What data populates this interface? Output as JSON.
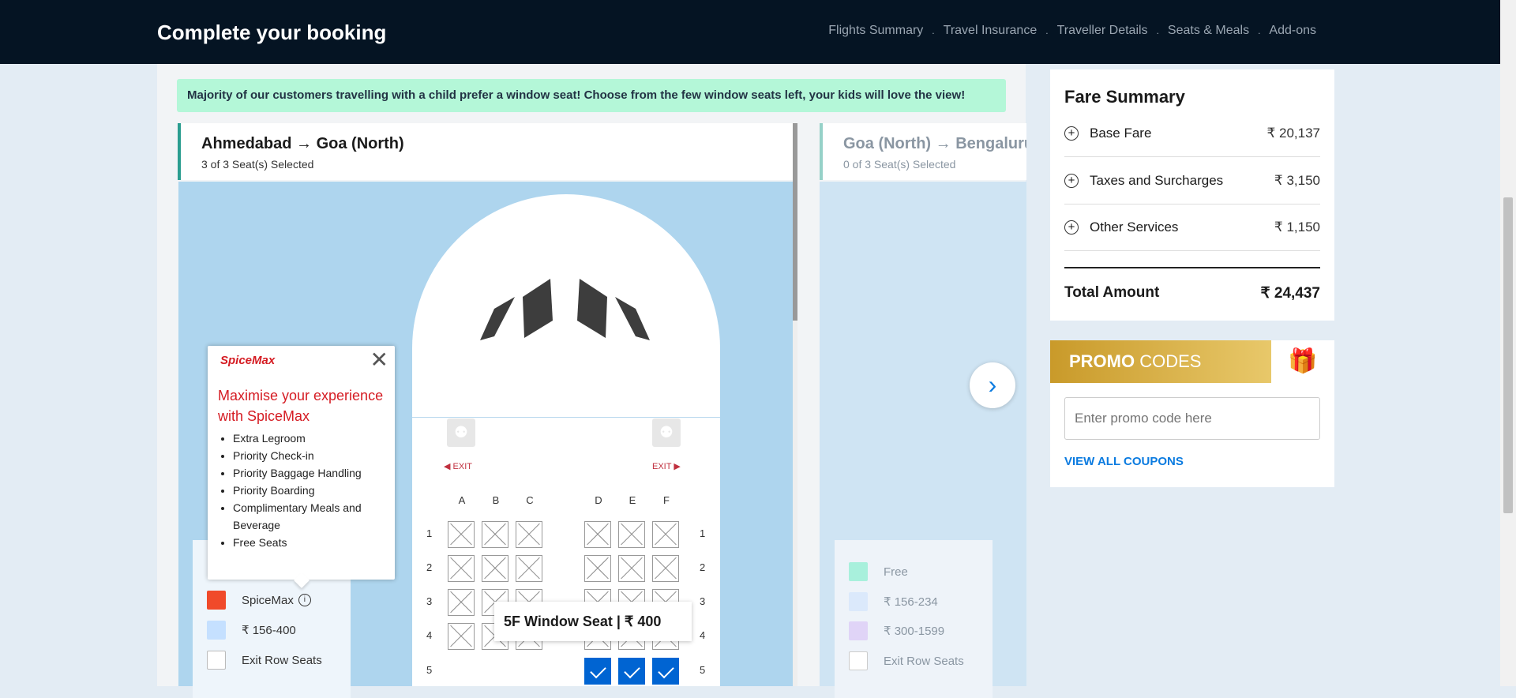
{
  "header": {
    "title": "Complete your booking",
    "steps": [
      "Flights Summary",
      "Travel Insurance",
      "Traveller Details",
      "Seats & Meals",
      "Add-ons"
    ]
  },
  "notice": "Majority of our customers travelling with a child prefer a window seat! Choose from the few window seats left, your kids will love the view!",
  "legs": [
    {
      "route": "Ahmedabad → Goa (North)",
      "status": "3 of 3 Seat(s) Selected"
    },
    {
      "route": "Goa (North) → Bengaluru",
      "status": "0 of 3 Seat(s) Selected"
    }
  ],
  "seatmap": {
    "columns": [
      "A",
      "B",
      "C",
      "D",
      "E",
      "F"
    ],
    "rows": [
      "1",
      "2",
      "3",
      "4",
      "5"
    ],
    "exit_label": "EXIT",
    "tooltip": "5F Window Seat | ₹ 400"
  },
  "popup": {
    "brand": "SpiceMax",
    "heading": "Maximise your experience with SpiceMax",
    "features": [
      "Extra Legroom",
      "Priority Check-in",
      "Priority Baggage Handling",
      "Priority Boarding",
      "Complimentary Meals and Beverage",
      "Free Seats"
    ]
  },
  "legend_left": [
    {
      "label": "SpiceMax",
      "color": "#f04a2a"
    },
    {
      "label": "₹ 156-400",
      "color": "#c5e0ff"
    },
    {
      "label": "Exit Row Seats",
      "color": "#ffffff"
    }
  ],
  "legend_right": [
    {
      "label": "Free",
      "color": "#a8f0dc"
    },
    {
      "label": "₹ 156-234",
      "color": "#dbe9fb"
    },
    {
      "label": "₹ 300-1599",
      "color": "#e0d4f7"
    },
    {
      "label": "Exit Row Seats",
      "color": "#ffffff"
    }
  ],
  "fare": {
    "title": "Fare Summary",
    "items": [
      {
        "label": "Base Fare",
        "amount": "₹ 20,137"
      },
      {
        "label": "Taxes and Surcharges",
        "amount": "₹ 3,150"
      },
      {
        "label": "Other Services",
        "amount": "₹ 1,150"
      }
    ],
    "total_label": "Total Amount",
    "total_amount": "₹ 24,437"
  },
  "promo": {
    "title_bold": "PROMO",
    "title_light": "CODES",
    "placeholder": "Enter promo code here",
    "view_all": "VIEW ALL COUPONS"
  },
  "colors": {
    "accent": "#0064d2",
    "header_bg": "#051423",
    "spicemax_red": "#d51c23"
  }
}
